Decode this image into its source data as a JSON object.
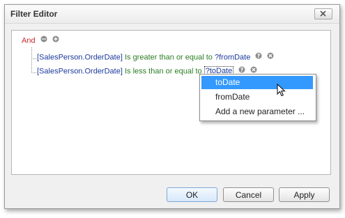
{
  "window": {
    "title": "Filter Editor"
  },
  "filter": {
    "group_label": "And",
    "conditions": [
      {
        "field": "[SalesPerson.OrderDate]",
        "operator": "Is greater than or equal to",
        "value": "?fromDate"
      },
      {
        "field": "[SalesPerson.OrderDate]",
        "operator": "Is less than or equal to",
        "value": "?toDate"
      }
    ]
  },
  "popup": {
    "items": [
      "toDate",
      "fromDate",
      "Add a new parameter ..."
    ],
    "selected_index": 0
  },
  "buttons": {
    "ok": "OK",
    "cancel": "Cancel",
    "apply": "Apply"
  },
  "colors": {
    "group": "#c0282e",
    "field": "#1d3a9c",
    "operator": "#2c7d25",
    "selection": "#3399ff"
  }
}
